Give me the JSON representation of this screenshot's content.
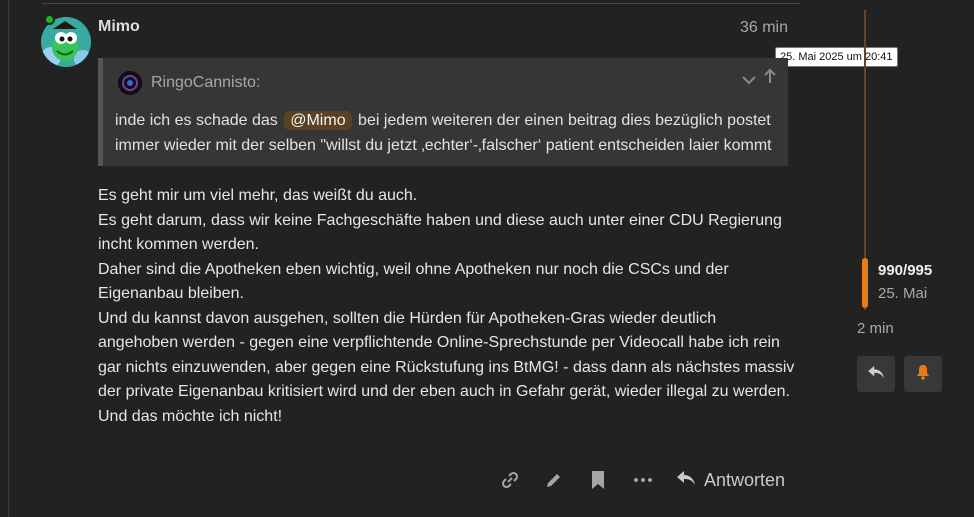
{
  "post": {
    "username": "Mimo",
    "time_ago": "36 min",
    "tooltip": "25. Mai 2025 um 20:41"
  },
  "quote": {
    "author": "RingoCannisto:",
    "text_before": "inde ich es schade das",
    "mention": "@Mimo",
    "text_after": "bei jedem weiteren der einen beitrag dies bezüglich postet immer wieder mit der selben \"willst du jetzt ‚echter‘-‚falscher‘ patient entscheiden laier kommt"
  },
  "body_lines": [
    "Es geht mir um viel mehr, das weißt du auch.",
    "Es geht darum, dass wir keine Fachgeschäfte haben und diese auch unter einer CDU Regierung incht kommen werden.",
    "Daher sind die Apotheken eben wichtig, weil ohne Apotheken nur noch die CSCs und der Eigenanbau bleiben.",
    "Und du kannst davon ausgehen, sollten die Hürden für Apotheken-Gras wieder deutlich angehoben werden - gegen eine verpflichtende Online-Sprechstunde per Videocall habe ich rein gar nichts einzuwenden, aber gegen eine Rückstufung ins BtMG! - dass dann als nächstes massiv der private Eigenanbau kritisiert wird und der eben auch in Gefahr gerät, wieder illegal zu werden. Und das möchte ich nicht!"
  ],
  "actions": {
    "reply_label": "Antworten",
    "icons": [
      "link-icon",
      "pencil-icon",
      "bookmark-icon",
      "more-icon",
      "reply-icon"
    ]
  },
  "timeline": {
    "count": "990/995",
    "date": "25. Mai",
    "ago": "2 min",
    "progress": 0.995
  },
  "colors": {
    "accent": "#e87b12",
    "background": "#222222",
    "mention_bg": "#5a4124",
    "status_online": "#1fb42a"
  }
}
